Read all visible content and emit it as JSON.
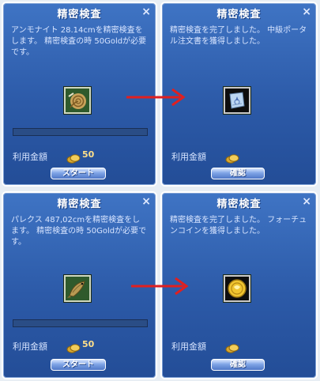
{
  "panels": [
    {
      "title": "精密検査",
      "message": "アンモナイト 28.14cmを精密検査をします。 精密検査の時 50Goldが必要です。",
      "cost_label": "利用金額",
      "amount": "50",
      "button": "スタート",
      "item_icon": "ammonite-icon"
    },
    {
      "title": "精密検査",
      "message": "精密検査を完了しました。 中級ポータル注文書を獲得しました。",
      "cost_label": "利用金額",
      "button": "確認",
      "item_icon": "portal-scroll-icon"
    },
    {
      "title": "精密検査",
      "message": "パレクス 487,02cmを精密検査をします。 精密検査の時 50Goldが必要です。",
      "cost_label": "利用金額",
      "amount": "50",
      "button": "スタート",
      "item_icon": "fish-icon"
    },
    {
      "title": "精密検査",
      "message": "精密検査を完了しました。 フォーチュンコインを獲得しました。",
      "cost_label": "利用金額",
      "button": "確認",
      "item_icon": "fortune-coin-icon"
    }
  ],
  "colors": {
    "panel": "#2c5aa8",
    "arrow": "#e02020",
    "amount": "#ffe08a"
  },
  "close_glyph": "×"
}
